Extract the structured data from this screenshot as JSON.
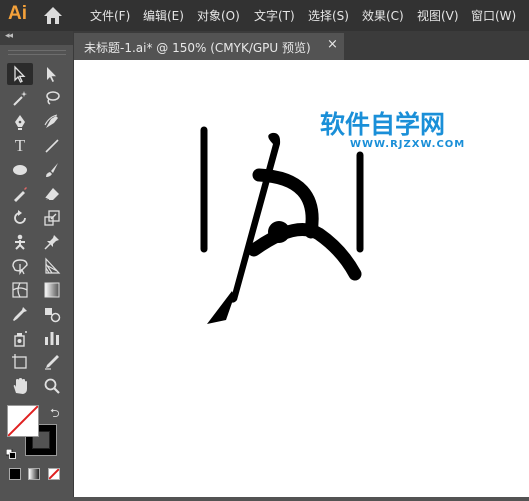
{
  "app": {
    "logo": "Ai",
    "accent_color": "#f4a13a"
  },
  "menu": [
    {
      "label": "文件(F)"
    },
    {
      "label": "编辑(E)"
    },
    {
      "label": "对象(O)"
    },
    {
      "label": "文字(T)"
    },
    {
      "label": "选择(S)"
    },
    {
      "label": "效果(C)"
    },
    {
      "label": "视图(V)"
    },
    {
      "label": "窗口(W)"
    }
  ],
  "document_tab": {
    "label": "未标题-1.ai* @ 150% (CMYK/GPU 预览)",
    "close": "×"
  },
  "toolbox": {
    "collapse": "◂◂",
    "type_tool_glyph": "T",
    "swap_glyph": "⮌",
    "tools": [
      "selection-tool",
      "direct-selection-tool",
      "magic-wand-tool",
      "lasso-tool",
      "pen-tool",
      "curvature-tool",
      "type-tool",
      "line-segment-tool",
      "ellipse-tool",
      "paintbrush-tool",
      "shaper-tool",
      "eraser-tool",
      "rotate-tool",
      "scale-tool",
      "puppet-warp-tool",
      "pin-tool",
      "free-transform-tool",
      "perspective-grid-tool",
      "mesh-tool",
      "gradient-tool",
      "eyedropper-tool",
      "blend-tool",
      "symbol-sprayer-tool",
      "column-graph-tool",
      "artboard-tool",
      "slice-tool",
      "hand-tool",
      "zoom-tool"
    ]
  },
  "colors": {
    "fill": "#ffffff",
    "stroke": "#000000",
    "none_slash": "#e02020"
  },
  "watermark": {
    "title": "软件自学网",
    "url": "WWW.RJZXW.COM",
    "color": "#1a8fd8"
  }
}
